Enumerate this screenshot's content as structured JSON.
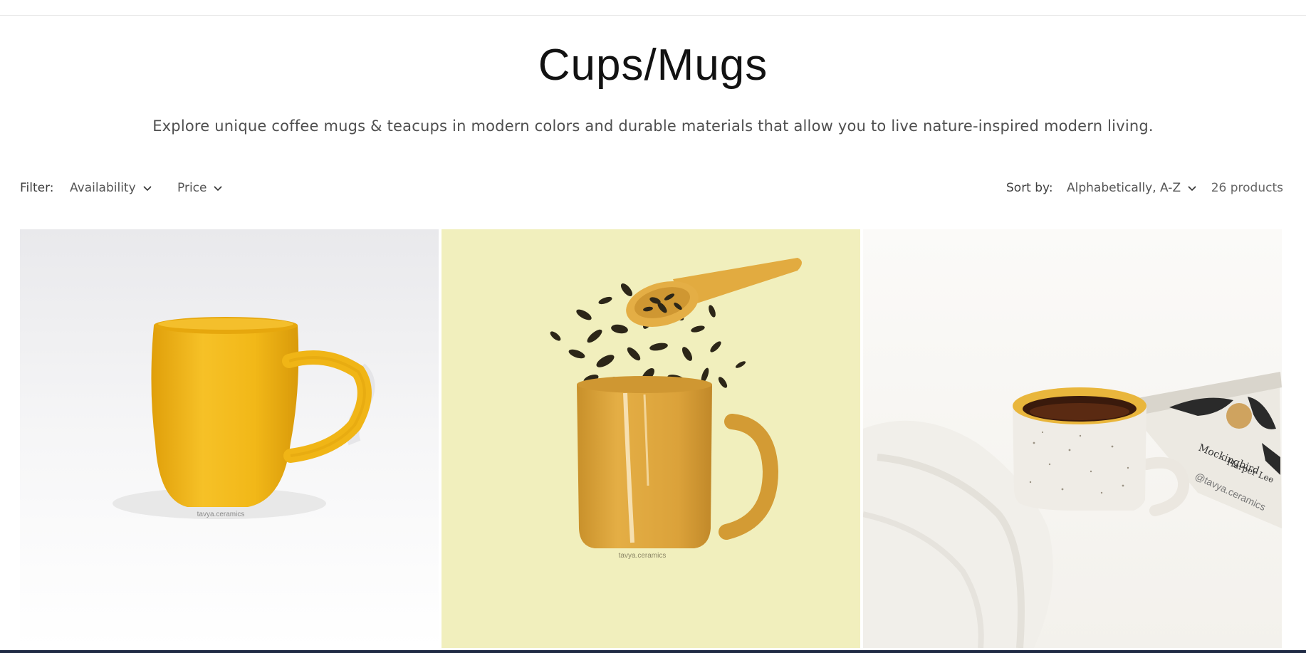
{
  "collection": {
    "title": "Cups/Mugs",
    "description": "Explore unique coffee mugs & teacups in modern colors and durable materials that allow you to live nature-inspired modern living."
  },
  "filters": {
    "label": "Filter:",
    "availability": "Availability",
    "price": "Price"
  },
  "sort": {
    "label": "Sort by:",
    "selected": "Alphabetically, A-Z"
  },
  "product_count": "26 products",
  "products": [
    {
      "image_watermark": "tavya.ceramics",
      "image_icon": "yellow-mug-photo"
    },
    {
      "image_watermark": "tavya.ceramics",
      "image_icon": "mustard-mug-tea-leaves-photo"
    },
    {
      "image_watermark": "@tavya.ceramics",
      "image_icon": "speckled-cup-with-tea-photo"
    }
  ],
  "colors": {
    "title": "#121212",
    "muted_text": "#4f4f4f",
    "mug_yellow": "#f2b713",
    "mustard": "#dfa93a",
    "pale_yellow_bg": "#f1efbd",
    "footer_bar": "#1f2a44"
  }
}
